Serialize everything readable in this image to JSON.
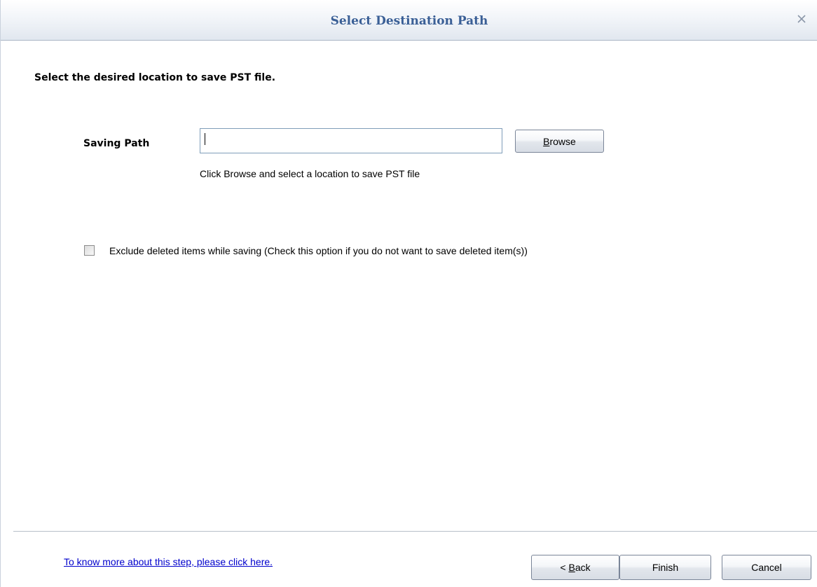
{
  "window": {
    "title": "Select Destination Path",
    "close_icon": "close-icon"
  },
  "content": {
    "instruction": "Select the desired location to save PST file.",
    "saving_path": {
      "label": "Saving Path",
      "value": "",
      "placeholder": ""
    },
    "browse_button": {
      "underlined_letter": "B",
      "rest": "rowse"
    },
    "hint": "Click Browse and select a location to save PST file",
    "exclude_deleted": {
      "checked": false,
      "label": "Exclude deleted items while saving  (Check this option if you do not want to save deleted item(s))"
    }
  },
  "footer": {
    "help_link": "To know more about this step, please click here.",
    "back_button": {
      "prefix": "< ",
      "underlined_letter": "B",
      "rest": "ack"
    },
    "finish_label": "Finish",
    "cancel_label": "Cancel"
  },
  "colors": {
    "title_text": "#3a5f96",
    "link": "#0000cc",
    "input_border": "#7f9db9"
  }
}
